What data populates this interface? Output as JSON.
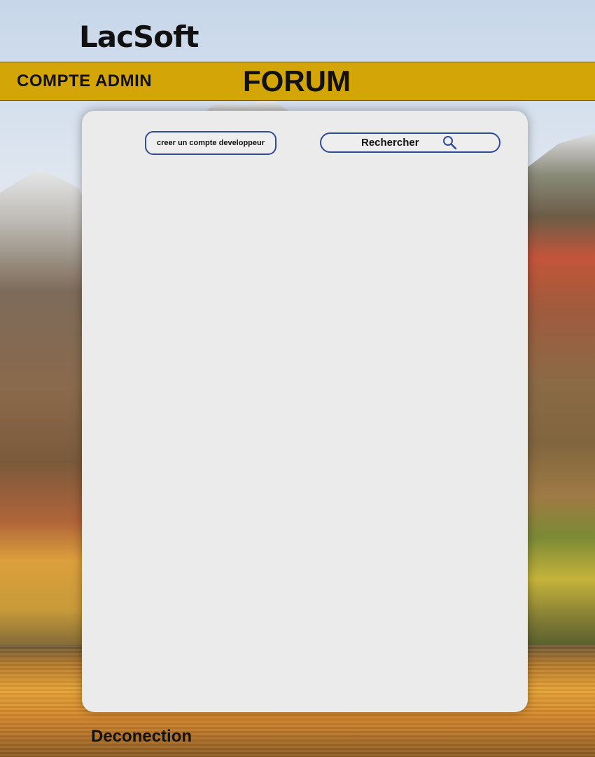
{
  "header": {
    "logo": "LacSoft",
    "account_label": "COMPTE ADMIN",
    "title": "FORUM"
  },
  "panel": {
    "create_button_label": "creer un compte developpeur",
    "search_label": "Rechercher",
    "search_icon": "magnifier-icon"
  },
  "footer": {
    "logout_label": "Deconection"
  },
  "colors": {
    "top_bar": "#d4a506",
    "button_border": "#2f4c98",
    "panel_bg": "#ebebec"
  }
}
